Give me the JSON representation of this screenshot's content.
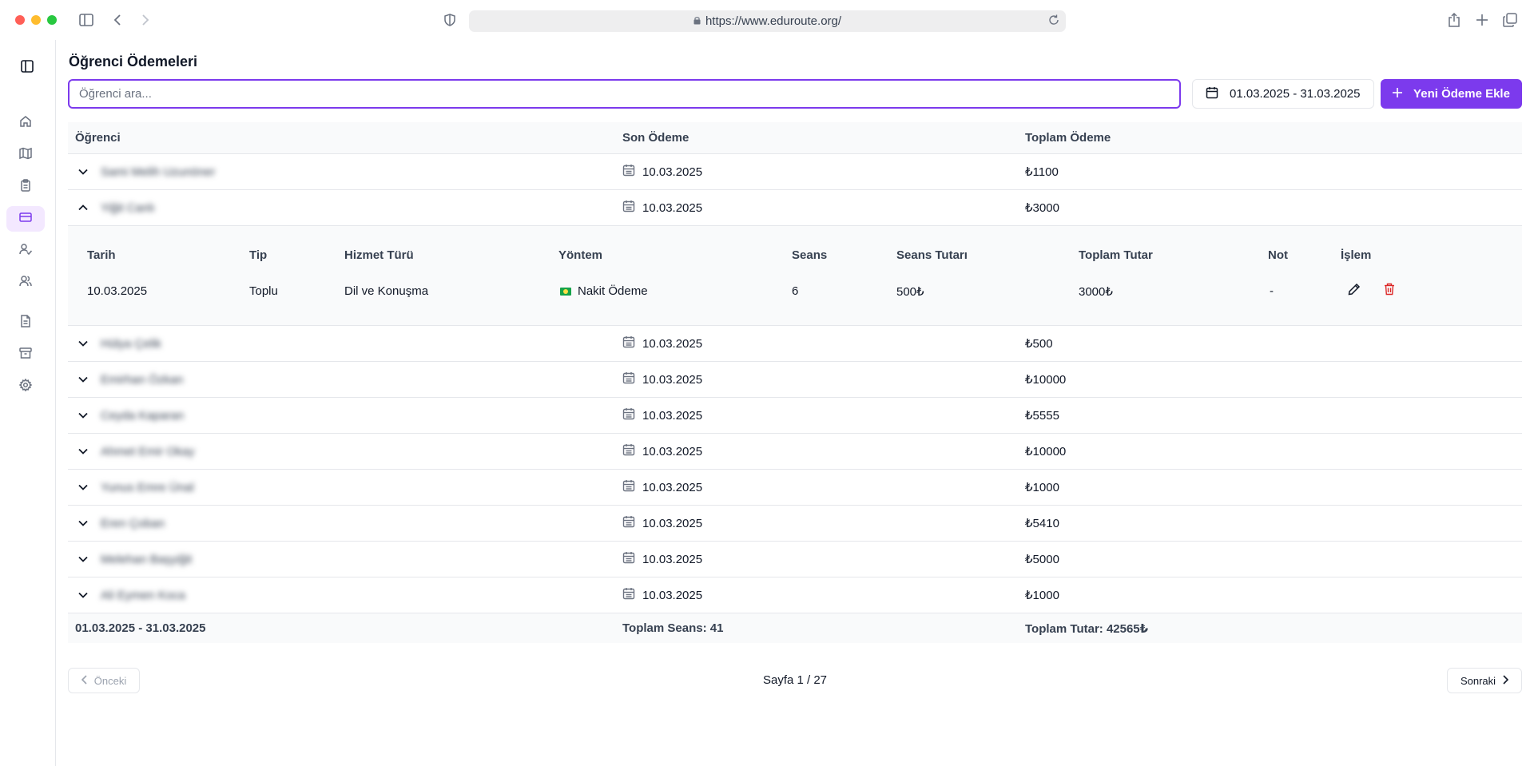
{
  "browser": {
    "url": "https://www.eduroute.org/"
  },
  "sidebar": {
    "items": [
      {
        "icon": "home-icon"
      },
      {
        "icon": "map-icon"
      },
      {
        "icon": "clipboard-icon"
      },
      {
        "icon": "credit-card-icon",
        "active": true
      },
      {
        "icon": "user-check-icon"
      },
      {
        "icon": "users-icon"
      },
      {
        "icon": "file-text-icon"
      },
      {
        "icon": "archive-icon"
      },
      {
        "icon": "settings-icon"
      }
    ]
  },
  "page": {
    "title": "Öğrenci Ödemeleri",
    "search_placeholder": "Öğrenci ara...",
    "date_range": "01.03.2025 - 31.03.2025",
    "add_button": "Yeni Ödeme Ekle"
  },
  "table": {
    "headers": {
      "student": "Öğrenci",
      "last_payment": "Son Ödeme",
      "total_payment": "Toplam Ödeme"
    },
    "rows": [
      {
        "name": "Sami Melih Uzunöner",
        "date": "10.03.2025",
        "total": "₺1100",
        "expanded": false
      },
      {
        "name": "Yiğit Canlı",
        "date": "10.03.2025",
        "total": "₺3000",
        "expanded": true
      },
      {
        "name": "Hülya Çelik",
        "date": "10.03.2025",
        "total": "₺500",
        "expanded": false
      },
      {
        "name": "Emirhan Özkan",
        "date": "10.03.2025",
        "total": "₺10000",
        "expanded": false
      },
      {
        "name": "Ceyda Kaparan",
        "date": "10.03.2025",
        "total": "₺5555",
        "expanded": false
      },
      {
        "name": "Ahmet Emir Okay",
        "date": "10.03.2025",
        "total": "₺10000",
        "expanded": false
      },
      {
        "name": "Yunus Emre Ünal",
        "date": "10.03.2025",
        "total": "₺1000",
        "expanded": false
      },
      {
        "name": "Eren Çoban",
        "date": "10.03.2025",
        "total": "₺5410",
        "expanded": false
      },
      {
        "name": "Melehan Başyiğit",
        "date": "10.03.2025",
        "total": "₺5000",
        "expanded": false
      },
      {
        "name": "Ali Eymen Koca",
        "date": "10.03.2025",
        "total": "₺1000",
        "expanded": false
      }
    ],
    "detail": {
      "headers": {
        "date": "Tarih",
        "type": "Tip",
        "service": "Hizmet Türü",
        "method": "Yöntem",
        "sessions": "Seans",
        "session_amount": "Seans Tutarı",
        "total_amount": "Toplam Tutar",
        "note": "Not",
        "action": "İşlem"
      },
      "row": {
        "date": "10.03.2025",
        "type": "Toplu",
        "service": "Dil ve Konuşma",
        "method": "Nakit Ödeme",
        "sessions": "6",
        "session_amount": "500₺",
        "total_amount": "3000₺",
        "note": "-"
      }
    },
    "footer": {
      "range": "01.03.2025 - 31.03.2025",
      "total_sessions": "Toplam Seans: 41",
      "total_amount": "Toplam Tutar: 42565₺"
    }
  },
  "pagination": {
    "prev": "Önceki",
    "next": "Sonraki",
    "info": "Sayfa 1 / 27"
  },
  "colors": {
    "accent": "#7c3aed",
    "delete": "#dc2626"
  }
}
